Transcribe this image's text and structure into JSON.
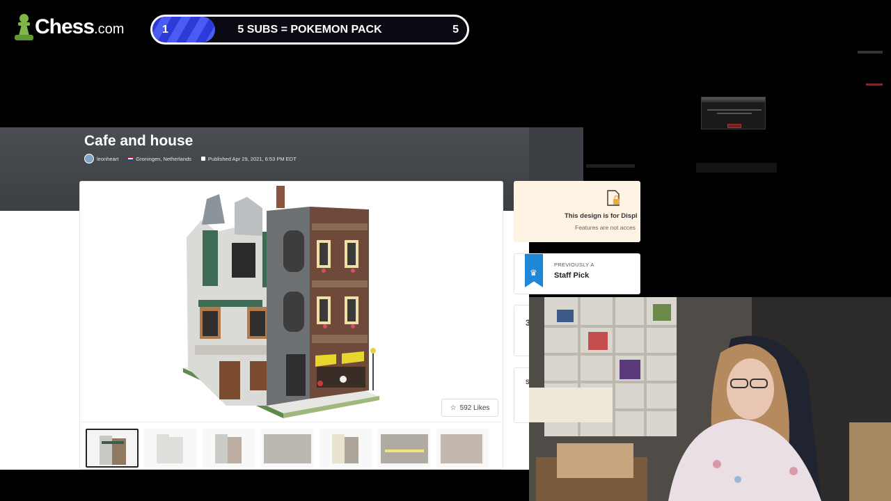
{
  "brand": {
    "logo_text": "Chess",
    "logo_suffix": ".com",
    "green": "#81b64c"
  },
  "sub_goal": {
    "current": "1",
    "label": "5 SUBS = POKEMON PACK",
    "target": "5",
    "progress": 0.2,
    "bar_color": "#2d3ad8"
  },
  "design_page": {
    "title": "Cafe and house",
    "author": "leonheart",
    "location": "Groningen, Netherlands",
    "published": "Published Apr 29, 2021, 6:53 PM EDT",
    "likes": "592 Likes",
    "thumbnail_count": 7
  },
  "sidebar": {
    "display_title": "This design is for Displ",
    "display_sub": "Features are not acces",
    "staff_small": "PREVIOUSLY A",
    "staff_large": "Staff Pick",
    "peek_1": "3",
    "peek_2": "S"
  },
  "icons": {
    "likes": "star-icon",
    "staff": "crown-icon",
    "display": "locked-document-icon"
  }
}
